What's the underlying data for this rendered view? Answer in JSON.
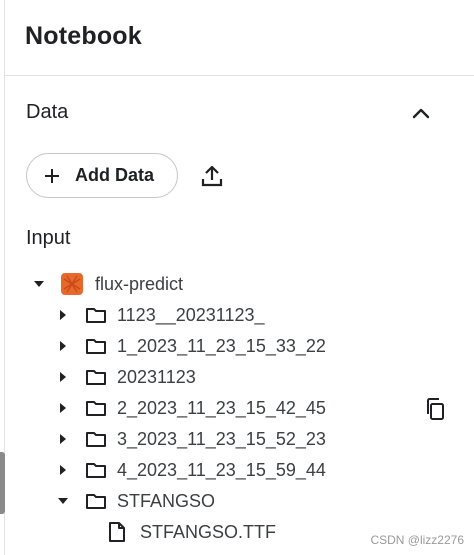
{
  "panel": {
    "title": "Notebook"
  },
  "data_section": {
    "title": "Data",
    "add_data_label": "Add Data"
  },
  "input_section": {
    "title": "Input",
    "dataset": {
      "name": "flux-predict",
      "icon": "dataset-icon",
      "icon_colors": [
        "#e8682a",
        "#c9491a"
      ],
      "folders": [
        {
          "name": "1123__20231123_",
          "expanded": false
        },
        {
          "name": "1_2023_11_23_15_33_22",
          "expanded": false
        },
        {
          "name": "20231123",
          "expanded": false
        },
        {
          "name": "2_2023_11_23_15_42_45",
          "expanded": false
        },
        {
          "name": "3_2023_11_23_15_52_23",
          "expanded": false
        },
        {
          "name": "4_2023_11_23_15_59_44",
          "expanded": false
        },
        {
          "name": "STFANGSO",
          "expanded": true,
          "files": [
            "STFANGSO.TTF"
          ]
        }
      ]
    }
  },
  "watermark": "CSDN @lizz2276"
}
